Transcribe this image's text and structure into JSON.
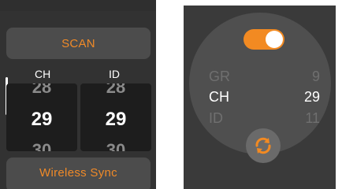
{
  "left_screen": {
    "scan_label": "SCAN",
    "columns": {
      "ch_label": "CH",
      "id_label": "ID"
    },
    "ch_picker": {
      "prev": "28",
      "current": "29",
      "next": "30"
    },
    "id_picker": {
      "prev": "28",
      "current": "29",
      "next": "30"
    },
    "sync_label": "Wireless Sync"
  },
  "right_screen": {
    "toggle_on": true,
    "rows": [
      {
        "label": "GR",
        "value": "9"
      },
      {
        "label": "CH",
        "value": "29"
      },
      {
        "label": "ID",
        "value": "11"
      }
    ],
    "sync_icon": "sync-arrows-icon"
  },
  "colors": {
    "accent": "#f28a22",
    "text": "#ffffff",
    "muted": "#6f6f6f"
  }
}
